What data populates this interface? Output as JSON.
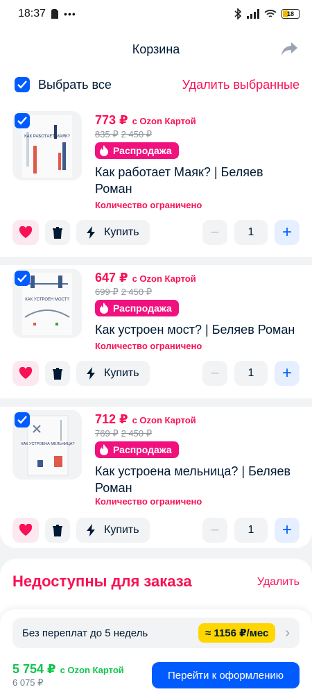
{
  "status": {
    "time": "18:37",
    "battery": "18"
  },
  "header": {
    "title": "Корзина"
  },
  "select_all": {
    "label": "Выбрать все",
    "delete_label": "Удалить выбранные"
  },
  "items": [
    {
      "price": "773 ₽",
      "card_label": "с Ozon Картой",
      "old_price_1": "835 ₽",
      "old_price_2": "2 450 ₽",
      "badge": "Распродажа",
      "name": "Как работает Маяк? | Беляев Роман",
      "limited": "Количество ограничено",
      "buy_label": "Купить",
      "qty": "1",
      "cover_text": "КАК РАБОТАЕТ МАЯК?"
    },
    {
      "price": "647 ₽",
      "card_label": "с Ozon Картой",
      "old_price_1": "699 ₽",
      "old_price_2": "2 450 ₽",
      "badge": "Распродажа",
      "name": "Как устроен мост? | Беляев Роман",
      "limited": "Количество ограничено",
      "buy_label": "Купить",
      "qty": "1",
      "cover_text": "КАК УСТРОЕН МОСТ?"
    },
    {
      "price": "712 ₽",
      "card_label": "с Ozon Картой",
      "old_price_1": "769 ₽",
      "old_price_2": "2 450 ₽",
      "badge": "Распродажа",
      "name": "Как устроена мельница? | Беляев Роман",
      "limited": "Количество ограничено",
      "buy_label": "Купить",
      "qty": "1",
      "cover_text": "КАК УСТРОЕНА МЕЛЬНИЦА?"
    }
  ],
  "unavailable": {
    "title": "Недоступны для заказа",
    "delete_label": "Удалить"
  },
  "bottom": {
    "installment_text": "Без переплат до 5 недель",
    "installment_amount": "≈ 1156 ₽/мес",
    "total": "5 754 ₽",
    "total_card_label": "с Ozon Картой",
    "total_old": "6 075 ₽",
    "checkout_label": "Перейти к оформлению"
  },
  "colors": {
    "accent": "#005bff",
    "sale": "#f91155",
    "green": "#10c44c",
    "yellow": "#ffd600"
  }
}
